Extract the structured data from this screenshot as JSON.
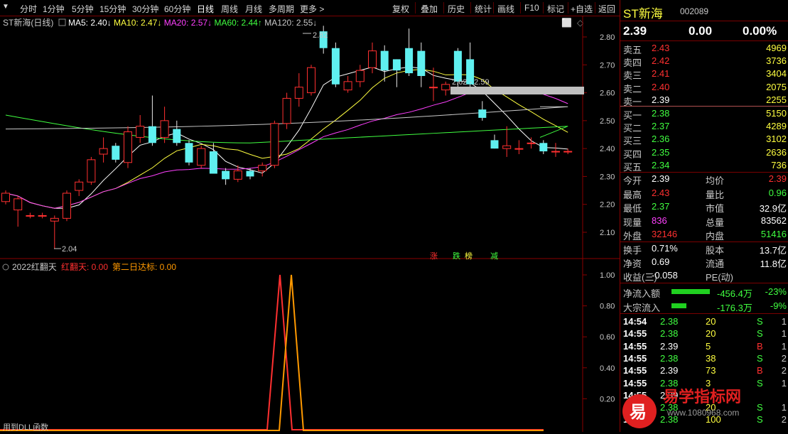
{
  "toolbar": {
    "periods": [
      "分时",
      "1分钟",
      "5分钟",
      "15分钟",
      "30分钟",
      "60分钟",
      "日线",
      "周线",
      "月线",
      "多周期",
      "更多 >"
    ],
    "active_period": "日线",
    "actions": [
      "复权",
      "叠加",
      "历史",
      "统计",
      "画线",
      "F10",
      "标记",
      "+自选",
      "返回"
    ]
  },
  "main_chart": {
    "title": "ST新海(日线)",
    "ma": [
      {
        "label": "MA5: 2.40",
        "arrow": "↓",
        "color": "#ffffff"
      },
      {
        "label": "MA10: 2.47",
        "arrow": "↓",
        "color": "#ffff40"
      },
      {
        "label": "MA20: 2.57",
        "arrow": "↓",
        "color": "#ff40ff"
      },
      {
        "label": "MA60: 2.44",
        "arrow": "↑",
        "color": "#40ff40"
      },
      {
        "label": "MA120: 2.55",
        "arrow": "↓",
        "color": "#c8c8c8"
      }
    ],
    "high_marker": "2.82",
    "low_marker": "2.04",
    "range_label": "2.62 - 2.59",
    "y_ticks": [
      "2.80",
      "2.70",
      "2.60",
      "2.50",
      "2.40",
      "2.30",
      "2.20",
      "2.10"
    ],
    "tags": [
      {
        "text": "涨",
        "color": "#ff3030"
      },
      {
        "text": "跌",
        "color": "#40ff40"
      },
      {
        "text": "榜",
        "color": "#ffff40"
      },
      {
        "text": "减",
        "color": "#40ff40"
      }
    ]
  },
  "chart_data": {
    "type": "candlestick",
    "y_range": [
      2.04,
      2.84
    ],
    "candles": [
      [
        2.21,
        2.24,
        2.2,
        2.25
      ],
      [
        2.18,
        2.22,
        2.12,
        2.23
      ],
      [
        2.16,
        2.16,
        2.15,
        2.17
      ],
      [
        2.16,
        2.16,
        2.15,
        2.17
      ],
      [
        2.14,
        2.15,
        2.04,
        2.16
      ],
      [
        2.15,
        2.24,
        2.14,
        2.25
      ],
      [
        2.25,
        2.28,
        2.23,
        2.29
      ],
      [
        2.28,
        2.36,
        2.27,
        2.37
      ],
      [
        2.38,
        2.4,
        2.35,
        2.44
      ],
      [
        2.41,
        2.36,
        2.35,
        2.42
      ],
      [
        2.35,
        2.46,
        2.33,
        2.48
      ],
      [
        2.44,
        2.48,
        2.42,
        2.52
      ],
      [
        2.48,
        2.42,
        2.41,
        2.59
      ],
      [
        2.44,
        2.5,
        2.42,
        2.55
      ],
      [
        2.47,
        2.42,
        2.41,
        2.5
      ],
      [
        2.42,
        2.35,
        2.34,
        2.43
      ],
      [
        2.34,
        2.4,
        2.33,
        2.41
      ],
      [
        2.39,
        2.31,
        2.31,
        2.42
      ],
      [
        2.32,
        2.29,
        2.27,
        2.33
      ],
      [
        2.29,
        2.32,
        2.28,
        2.34
      ],
      [
        2.32,
        2.3,
        2.29,
        2.33
      ],
      [
        2.32,
        2.34,
        2.3,
        2.35
      ],
      [
        2.34,
        2.49,
        2.33,
        2.5
      ],
      [
        2.49,
        2.58,
        2.47,
        2.6
      ],
      [
        2.58,
        2.62,
        2.55,
        2.67
      ],
      [
        2.6,
        2.69,
        2.59,
        2.7
      ],
      [
        2.82,
        2.76,
        2.74,
        2.84
      ],
      [
        2.76,
        2.63,
        2.62,
        2.78
      ],
      [
        2.61,
        2.64,
        2.6,
        2.66
      ],
      [
        2.64,
        2.68,
        2.62,
        2.7
      ],
      [
        2.69,
        2.75,
        2.67,
        2.78
      ],
      [
        2.75,
        2.68,
        2.64,
        2.77
      ],
      [
        2.72,
        2.68,
        2.62,
        2.72
      ],
      [
        2.76,
        2.67,
        2.66,
        2.83
      ],
      [
        2.75,
        2.66,
        2.62,
        2.78
      ],
      [
        2.62,
        2.62,
        2.57,
        2.69
      ],
      [
        2.61,
        2.63,
        2.59,
        2.64
      ],
      [
        2.75,
        2.64,
        2.6,
        2.76
      ],
      [
        2.72,
        2.63,
        2.6,
        2.78
      ],
      [
        2.54,
        2.51,
        2.5,
        2.57
      ],
      [
        2.43,
        2.4,
        2.4,
        2.45
      ],
      [
        2.4,
        2.41,
        2.37,
        2.48
      ],
      [
        2.4,
        2.4,
        2.38,
        2.43
      ],
      [
        2.42,
        2.42,
        2.4,
        2.44
      ],
      [
        2.42,
        2.39,
        2.38,
        2.43
      ],
      [
        2.39,
        2.39,
        2.37,
        2.42
      ],
      [
        2.39,
        2.39,
        2.38,
        2.4
      ]
    ]
  },
  "sub_chart": {
    "title": "2022红翻天",
    "label1": "红翻天: 0.00",
    "label2": "第二日达标: 0.00",
    "y_ticks": [
      "1.00",
      "0.80",
      "0.60",
      "0.40",
      "0.20"
    ],
    "footer": "用到DLL函数"
  },
  "quote": {
    "name": "ST新海",
    "code": "002089",
    "price": "2.39",
    "change": "0.00",
    "pct": "0.00%",
    "asks": [
      {
        "label": "卖五",
        "price": "2.43",
        "vol": "4969",
        "color": "#ff3030"
      },
      {
        "label": "卖四",
        "price": "2.42",
        "vol": "3736",
        "color": "#ff3030"
      },
      {
        "label": "卖三",
        "price": "2.41",
        "vol": "3404",
        "color": "#ff3030"
      },
      {
        "label": "卖二",
        "price": "2.40",
        "vol": "2075",
        "color": "#ff3030"
      },
      {
        "label": "卖一",
        "price": "2.39",
        "vol": "2255",
        "color": "#ffffff"
      }
    ],
    "bids": [
      {
        "label": "买一",
        "price": "2.38",
        "vol": "5150",
        "color": "#40ff40"
      },
      {
        "label": "买二",
        "price": "2.37",
        "vol": "4289",
        "color": "#40ff40"
      },
      {
        "label": "买三",
        "price": "2.36",
        "vol": "3102",
        "color": "#40ff40"
      },
      {
        "label": "买四",
        "price": "2.35",
        "vol": "2636",
        "color": "#40ff40"
      },
      {
        "label": "买五",
        "price": "2.34",
        "vol": "736",
        "color": "#40ff40"
      }
    ],
    "stats": [
      {
        "l1": "今开",
        "v1": "2.39",
        "c1": "#ffffff",
        "l2": "均价",
        "v2": "2.39",
        "c2": "#ff3030"
      },
      {
        "l1": "最高",
        "v1": "2.43",
        "c1": "#ff3030",
        "l2": "量比",
        "v2": "0.96",
        "c2": "#40ff40"
      },
      {
        "l1": "最低",
        "v1": "2.37",
        "c1": "#40ff40",
        "l2": "市值",
        "v2": "32.9亿",
        "c2": "#ffffff"
      },
      {
        "l1": "现量",
        "v1": "836",
        "c1": "#ff40ff",
        "l2": "总量",
        "v2": "83562",
        "c2": "#ffffff"
      },
      {
        "l1": "外盘",
        "v1": "32146",
        "c1": "#ff3030",
        "l2": "内盘",
        "v2": "51416",
        "c2": "#40ff40"
      }
    ],
    "stats2": [
      {
        "l1": "换手",
        "v1": "0.71%",
        "l2": "股本",
        "v2": "13.7亿"
      },
      {
        "l1": "净资",
        "v1": "0.69",
        "l2": "流通",
        "v2": "11.8亿"
      },
      {
        "l1": "收益(三)",
        "v1": "-0.058",
        "l2": "PE(动)",
        "v2": ""
      }
    ],
    "flows": [
      {
        "label": "净流入额",
        "value": "-456.4万",
        "pct": "-23%",
        "bar": 0.23
      },
      {
        "label": "大宗流入",
        "value": "-176.3万",
        "pct": "-9%",
        "bar": 0.09
      }
    ],
    "ticks": [
      {
        "time": "14:54",
        "price": "2.38",
        "vol": "20",
        "side": "S",
        "n": "1"
      },
      {
        "time": "14:55",
        "price": "2.38",
        "vol": "20",
        "side": "S",
        "n": "1"
      },
      {
        "time": "14:55",
        "price": "2.39",
        "vol": "5",
        "side": "B",
        "n": "1"
      },
      {
        "time": "14:55",
        "price": "2.38",
        "vol": "38",
        "side": "S",
        "n": "2"
      },
      {
        "time": "14:55",
        "price": "2.39",
        "vol": "73",
        "side": "B",
        "n": "2"
      },
      {
        "time": "14:55",
        "price": "2.38",
        "vol": "3",
        "side": "S",
        "n": "1"
      },
      {
        "time": "14:55",
        "price": "2.39",
        "vol": "",
        "side": "",
        "n": ""
      },
      {
        "time": "14:55",
        "price": "2.38",
        "vol": "20",
        "side": "S",
        "n": "1"
      },
      {
        "time": "15:00",
        "price": "2.38",
        "vol": "100",
        "side": "S",
        "n": "2"
      }
    ]
  },
  "watermark": {
    "text": "易学指标网",
    "url": "www.1080968.com",
    "logo_char": "易"
  }
}
